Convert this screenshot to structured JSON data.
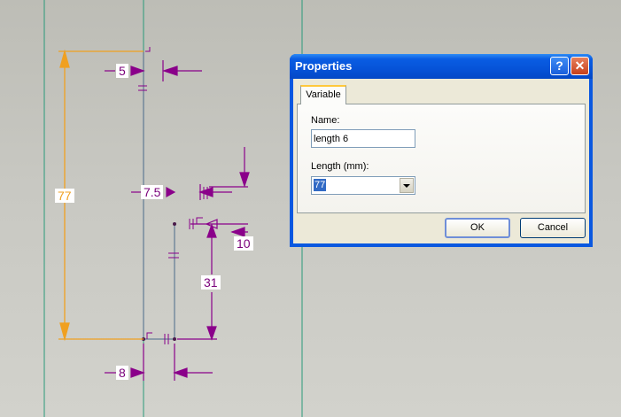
{
  "sketch": {
    "dimensions": {
      "d77": "77",
      "d5": "5",
      "d7_5": "7.5",
      "d10": "10",
      "d31": "31",
      "d8": "8"
    },
    "colors": {
      "construction_line": "#2a9a7a",
      "geometry": "#4a6a8a",
      "dimension": "#8a008a",
      "selected_dimension": "#f0a020"
    }
  },
  "dialog": {
    "title": "Properties",
    "help_icon": "?",
    "close_icon": "✕",
    "tab_label": "Variable",
    "name_label": "Name:",
    "name_value": "length 6",
    "length_label": "Length (mm):",
    "length_value": "77",
    "ok_label": "OK",
    "cancel_label": "Cancel"
  }
}
